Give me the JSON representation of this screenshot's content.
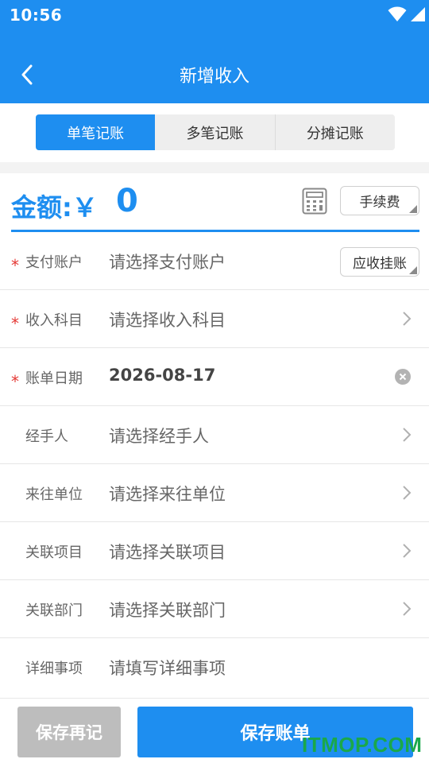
{
  "status_bar": {
    "time": "10:56"
  },
  "nav": {
    "title": "新增收入"
  },
  "tabs": [
    {
      "label": "单笔记账",
      "active": true
    },
    {
      "label": "多笔记账",
      "active": false
    },
    {
      "label": "分摊记账",
      "active": false
    }
  ],
  "amount": {
    "label": "金额:￥",
    "value": "0",
    "fee_button": "手续费"
  },
  "fields": [
    {
      "required": true,
      "label": "支付账户",
      "value": "请选择支付账户",
      "action_button": "应收挂账"
    },
    {
      "required": true,
      "label": "收入科目",
      "value": "请选择收入科目"
    },
    {
      "required": true,
      "label": "账单日期",
      "value": "2026-08-17"
    },
    {
      "required": false,
      "label": "经手人",
      "value": "请选择经手人"
    },
    {
      "required": false,
      "label": "来往单位",
      "value": "请选择来往单位"
    },
    {
      "required": false,
      "label": "关联项目",
      "value": "请选择关联项目"
    },
    {
      "required": false,
      "label": "关联部门",
      "value": "请选择关联部门"
    },
    {
      "required": false,
      "label": "详细事项",
      "value": "请填写详细事项"
    }
  ],
  "required_mark": "*",
  "footer": {
    "save_again": "保存再记",
    "save": "保存账单"
  },
  "watermark": "ITMOP.COM",
  "colors": {
    "primary": "#1e8ef0",
    "required": "#e53935",
    "disabled": "#bdbdbd",
    "watermark": "#1aa84a"
  },
  "icons": [
    "back-arrow-icon",
    "wifi-icon",
    "cell-signal-icon",
    "battery-icon",
    "calculator-icon",
    "chevron-right-icon",
    "clear-icon"
  ]
}
